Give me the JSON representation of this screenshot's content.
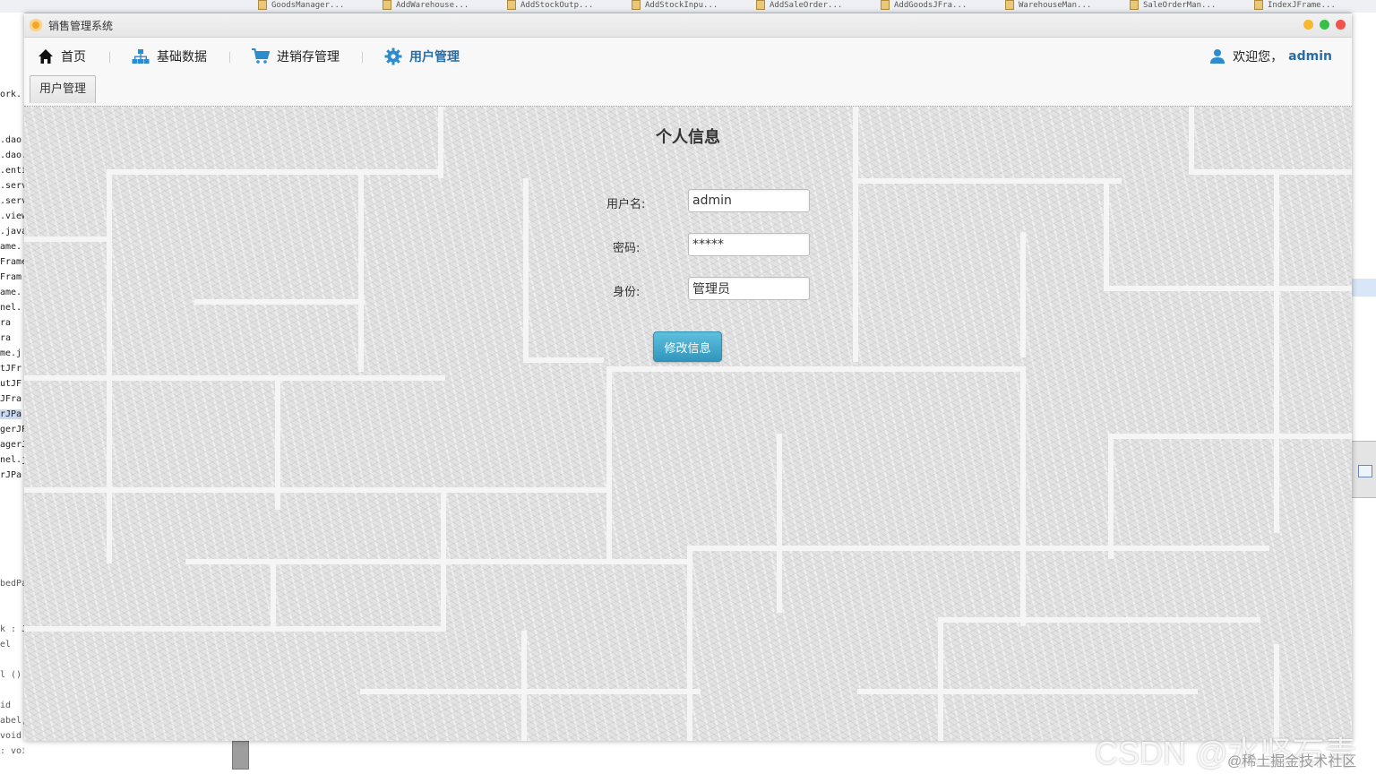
{
  "ide": {
    "tabs": [
      "GoodsManager...",
      "AddWarehouse...",
      "AddStockOutp...",
      "AddStockInpu...",
      "AddSaleOrder...",
      "AddGoodsJFra...",
      "WarehouseMan...",
      "SaleOrderMan...",
      "IndexJFrame..."
    ],
    "left_lines": [
      "ork.",
      ".dao",
      ".dao.",
      ".enti",
      ".serv",
      ".serv",
      ".view",
      ".java",
      "ame.",
      "Frame",
      "Fram",
      "ame.",
      "nel.",
      "ra",
      "ra",
      "me.j",
      "tJFr",
      "utJF",
      "JFra",
      "rJPa",
      "gerJP",
      "agerJ",
      "nel.j",
      "rJPa"
    ],
    "left_code": [
      "bedPa",
      "k : J",
      "el",
      "l ()",
      "id",
      "abel,",
      "void",
      ": void"
    ]
  },
  "app": {
    "title": "销售管理系统"
  },
  "nav": {
    "home": "首页",
    "basic_data": "基础数据",
    "inventory": "进销存管理",
    "user_mgmt": "用户管理",
    "welcome": "欢迎您，",
    "username": "admin"
  },
  "tabs": {
    "active": "用户管理"
  },
  "form": {
    "title": "个人信息",
    "username_label": "用户名:",
    "username_value": "admin",
    "password_label": "密码:",
    "password_value": "*****",
    "role_label": "身份:",
    "role_value": "管理员",
    "submit_label": "修改信息"
  },
  "watermark": {
    "main": "CSDN @水坚石青",
    "sub": "@稀土掘金技术社区"
  },
  "colors": {
    "accent": "#2b6ca3",
    "button": "#3196bd",
    "nav_icon": "#2b8ccf"
  }
}
